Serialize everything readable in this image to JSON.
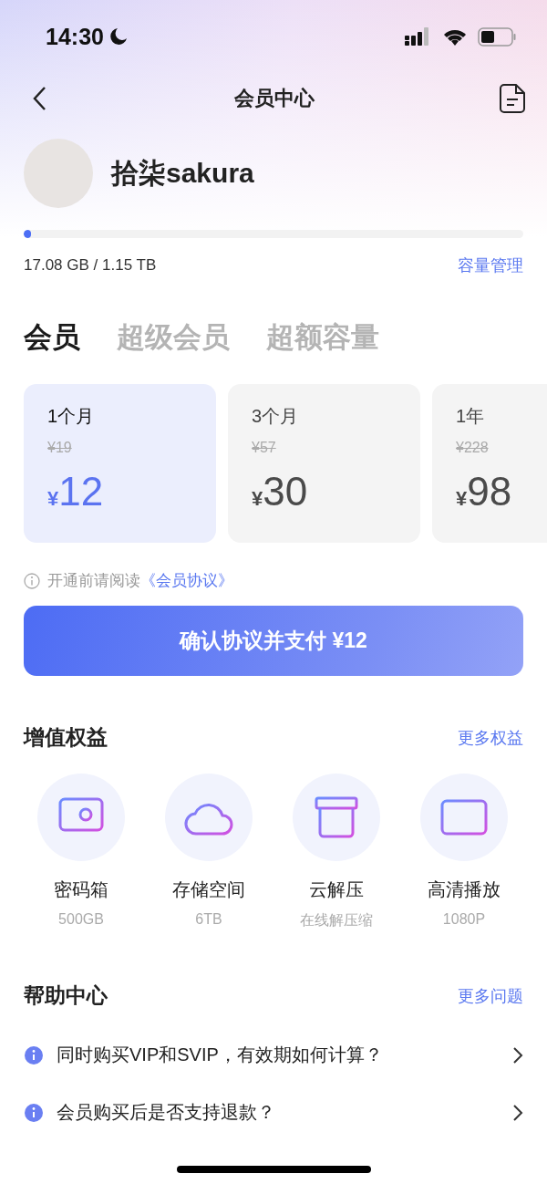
{
  "status_bar": {
    "time": "14:30"
  },
  "nav": {
    "title": "会员中心"
  },
  "user": {
    "name": "拾柒sakura"
  },
  "storage": {
    "level": 0.015,
    "usage": "17.08 GB / 1.15 TB",
    "manage_link": "容量管理"
  },
  "tabs": [
    {
      "label": "会员",
      "selected": true
    },
    {
      "label": "超级会员",
      "selected": false
    },
    {
      "label": "超额容量",
      "selected": false
    }
  ],
  "plans": [
    {
      "period": "1个月",
      "original_price": "¥19",
      "currency": "¥",
      "price": "12",
      "selected": true
    },
    {
      "period": "3个月",
      "original_price": "¥57",
      "currency": "¥",
      "price": "30",
      "selected": false
    },
    {
      "period": "1年",
      "original_price": "¥228",
      "currency": "¥",
      "price": "98",
      "selected": false
    }
  ],
  "agreement": {
    "text": "开通前请阅读",
    "link": "《会员协议》"
  },
  "pay_button": "确认协议并支付 ¥12",
  "benefits": {
    "title": "增值权益",
    "more": "更多权益",
    "items": [
      {
        "kind": "safe",
        "name": "密码箱",
        "detail": "500GB"
      },
      {
        "kind": "cloud",
        "name": "存储空间",
        "detail": "6TB"
      },
      {
        "kind": "archive",
        "name": "云解压",
        "detail": "在线解压缩"
      },
      {
        "kind": "card",
        "name": "高清播放",
        "detail": "1080P"
      }
    ]
  },
  "help": {
    "title": "帮助中心",
    "more": "更多问题",
    "items": [
      "同时购买VIP和SVIP，有效期如何计算？",
      "会员购买后是否支持退款？"
    ]
  }
}
